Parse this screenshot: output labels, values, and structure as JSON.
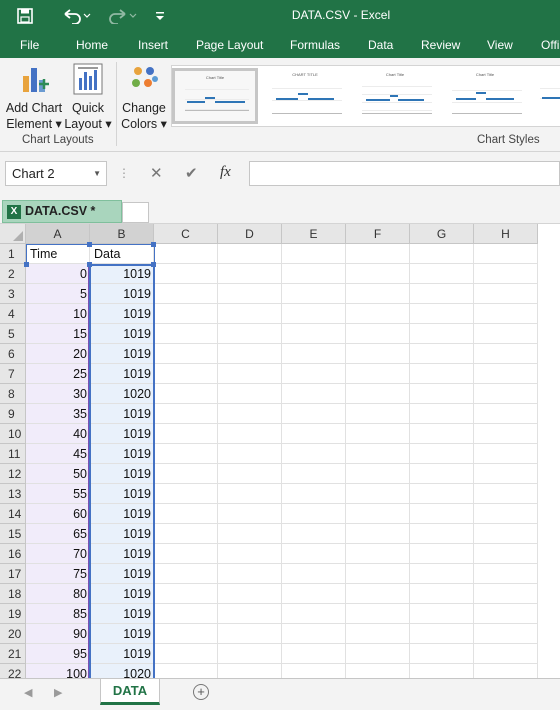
{
  "titlebar": {
    "title": "DATA.CSV - Excel",
    "qat": [
      "save-icon",
      "undo-icon",
      "redo-icon",
      "customize-icon"
    ]
  },
  "ribbon_tabs": [
    "File",
    "Home",
    "Insert",
    "Page Layout",
    "Formulas",
    "Data",
    "Review",
    "View",
    "Offi"
  ],
  "ribbon": {
    "add_chart_element": [
      "Add Chart",
      "Element ▾"
    ],
    "quick_layout": [
      "Quick",
      "Layout ▾"
    ],
    "change_colors": [
      "Change",
      "Colors ▾"
    ],
    "group_chart_layouts": "Chart Layouts",
    "group_chart_styles": "Chart Styles",
    "style_thumbnails": [
      "Chart Title",
      "CHART TITLE",
      "Chart Title",
      "Chart Title"
    ]
  },
  "formula_bar": {
    "name_box": "Chart 2",
    "fx": "fx",
    "cancel_icon": "✕",
    "enter_icon": "✔"
  },
  "workbook_tab": {
    "label": "DATA.CSV *"
  },
  "grid": {
    "columns": [
      "A",
      "B",
      "C",
      "D",
      "E",
      "F",
      "G",
      "H"
    ],
    "header_row": [
      "Time",
      "Data"
    ],
    "rows": [
      [
        0,
        1019
      ],
      [
        5,
        1019
      ],
      [
        10,
        1019
      ],
      [
        15,
        1019
      ],
      [
        20,
        1019
      ],
      [
        25,
        1019
      ],
      [
        30,
        1020
      ],
      [
        35,
        1019
      ],
      [
        40,
        1019
      ],
      [
        45,
        1019
      ],
      [
        50,
        1019
      ],
      [
        55,
        1019
      ],
      [
        60,
        1019
      ],
      [
        65,
        1019
      ],
      [
        70,
        1019
      ],
      [
        75,
        1019
      ],
      [
        80,
        1019
      ],
      [
        85,
        1019
      ],
      [
        90,
        1019
      ],
      [
        95,
        1019
      ],
      [
        100,
        1020
      ]
    ]
  },
  "sheet_tabs": {
    "active": "DATA",
    "add_sheet": "+"
  },
  "colors": {
    "excel_green": "#217346",
    "selection_purple": "#7b4fb4",
    "selection_blue": "#4472c4",
    "series_line": "#2e75b6"
  }
}
